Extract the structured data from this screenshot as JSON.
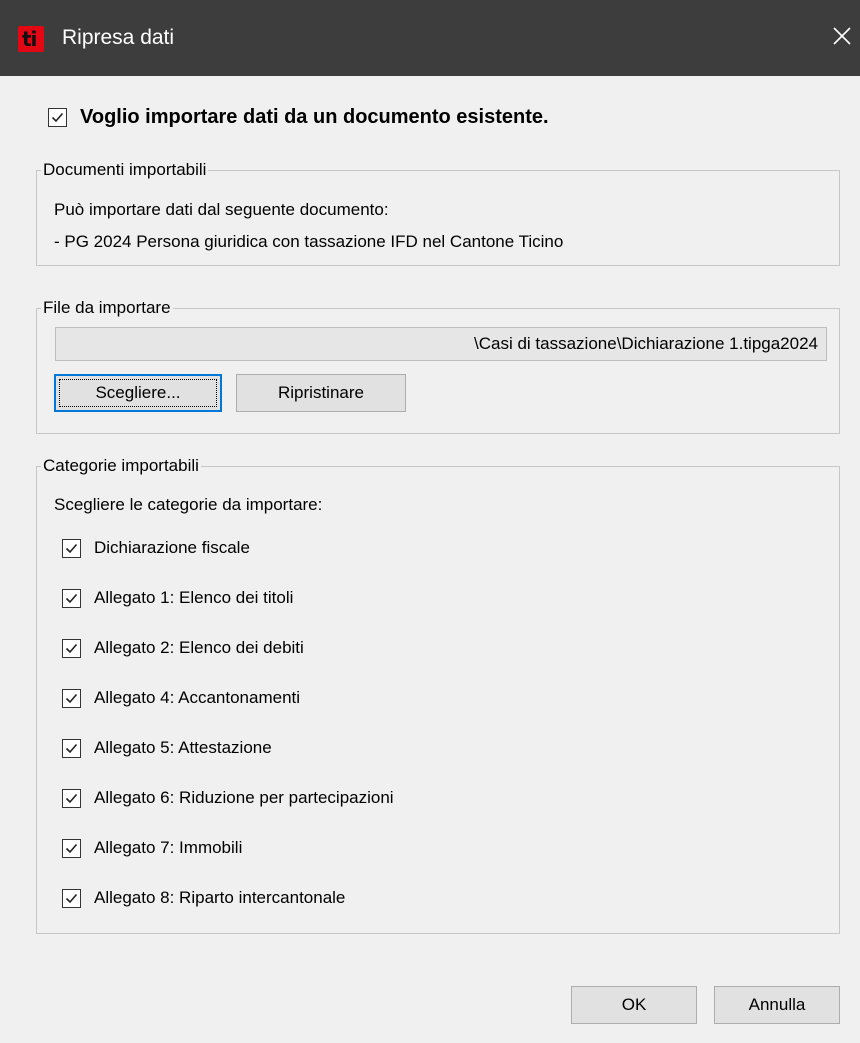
{
  "window": {
    "logo_text": "ti",
    "title": "Ripresa dati",
    "close_icon": "close-icon"
  },
  "main_option": {
    "checked": true,
    "label": "Voglio importare dati da un documento esistente."
  },
  "documents": {
    "legend": "Documenti importabili",
    "intro": "Può importare dati dal seguente documento:",
    "item": "- PG 2024 Persona giuridica con tassazione IFD nel Cantone Ticino"
  },
  "file": {
    "legend": "File da importare",
    "path": "\\Casi di tassazione\\Dichiarazione 1.tipga2024",
    "choose_label": "Scegliere...",
    "reset_label": "Ripristinare"
  },
  "categories": {
    "legend": "Categorie importabili",
    "intro": "Scegliere le categorie da importare:",
    "items": [
      {
        "label": "Dichiarazione fiscale",
        "checked": true
      },
      {
        "label": "Allegato 1: Elenco dei titoli",
        "checked": true
      },
      {
        "label": "Allegato 2: Elenco dei debiti",
        "checked": true
      },
      {
        "label": "Allegato 4: Accantonamenti",
        "checked": true
      },
      {
        "label": "Allegato 5: Attestazione",
        "checked": true
      },
      {
        "label": "Allegato 6: Riduzione per partecipazioni",
        "checked": true
      },
      {
        "label": "Allegato 7: Immobili",
        "checked": true
      },
      {
        "label": "Allegato 8: Riparto intercantonale",
        "checked": true
      }
    ]
  },
  "buttons": {
    "ok": "OK",
    "cancel": "Annulla"
  },
  "colors": {
    "titlebar": "#3d3d3d",
    "logo_red": "#e30613",
    "focus_blue": "#0078d7",
    "dialog_bg": "#f0f0f0"
  }
}
